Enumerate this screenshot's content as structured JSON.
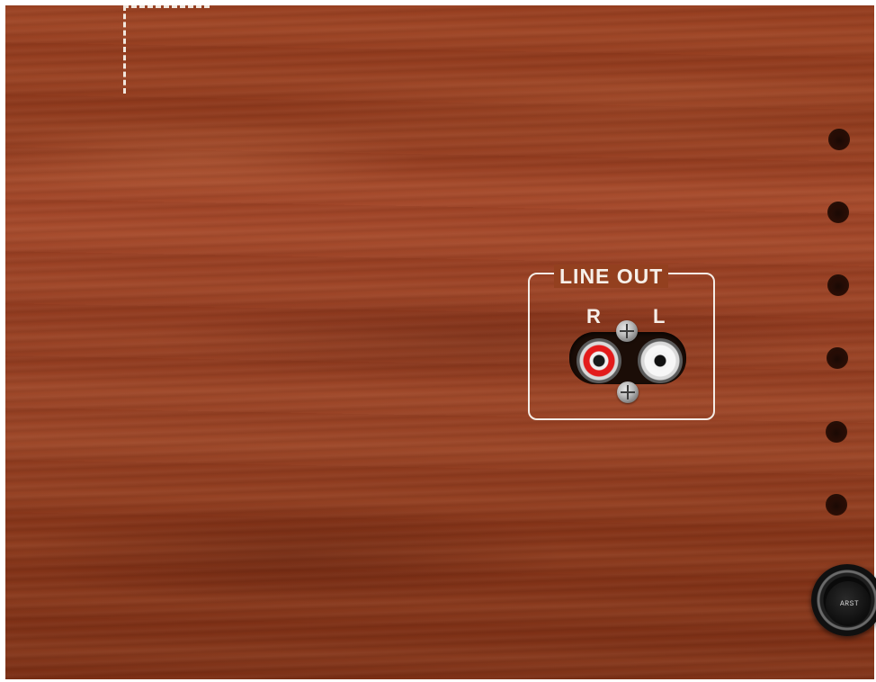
{
  "panel": {
    "material": "wood veneer",
    "colors": {
      "wood": "#93401f",
      "print": "#f4ece6"
    }
  },
  "line_out": {
    "title": "LINE OUT",
    "right_label": "R",
    "left_label": "L",
    "right_jack_color": "#e31b1b",
    "left_jack_color": "#f7f7f7"
  },
  "vent_holes": {
    "count": 6
  },
  "knob": {
    "visible_text": "ARST"
  },
  "icons": {
    "corner": "dashed-corner-marking",
    "screw": "phillips-screw-icon",
    "jack": "rca-jack-icon"
  }
}
